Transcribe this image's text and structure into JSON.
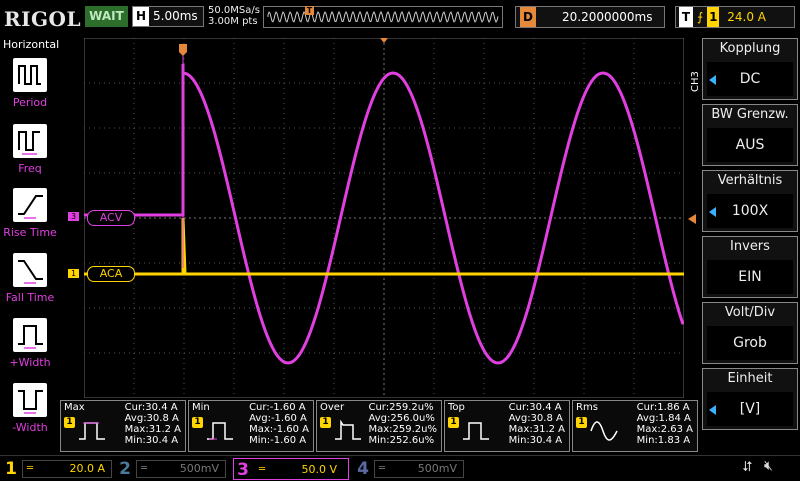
{
  "topbar": {
    "brand": "RIGOL",
    "run_status": "WAIT",
    "horizontal": {
      "key": "H",
      "value": "5.00ms"
    },
    "sample_rate": "50.0MSa/s",
    "memory_depth": "3.00M pts",
    "delay": {
      "key": "D",
      "value": "20.2000000ms"
    },
    "trigger": {
      "key": "T",
      "channel": "1",
      "level": "24.0 A"
    }
  },
  "left_panel": {
    "title": "Horizontal",
    "items": [
      {
        "label": "Period",
        "icon": "period-icon"
      },
      {
        "label": "Freq",
        "icon": "freq-icon"
      },
      {
        "label": "Rise Time",
        "icon": "rise-time-icon"
      },
      {
        "label": "Fall Time",
        "icon": "fall-time-icon"
      },
      {
        "label": "+Width",
        "icon": "pos-width-icon"
      },
      {
        "label": "-Width",
        "icon": "neg-width-icon"
      }
    ]
  },
  "channel_labels": {
    "ch3": {
      "marker": "3",
      "text": "ACV"
    },
    "ch1": {
      "marker": "1",
      "text": "ACA"
    }
  },
  "right_panel": {
    "channel_tag": "CH3",
    "items": [
      {
        "title": "Kopplung",
        "value": "DC",
        "has_arrow": true
      },
      {
        "title": "BW Grenzw.",
        "value": "AUS",
        "has_arrow": false
      },
      {
        "title": "Verhältnis",
        "value": "100X",
        "has_arrow": true
      },
      {
        "title": "Invers",
        "value": "EIN",
        "has_arrow": false
      },
      {
        "title": "Volt/Div",
        "value": "Grob",
        "has_arrow": false
      },
      {
        "title": "Einheit",
        "value": "[V]",
        "has_arrow": true
      }
    ]
  },
  "measurements": [
    {
      "name": "Max",
      "channel": "1",
      "cur": "Cur:30.4 A",
      "avg": "Avg:30.8 A",
      "max": "Max:31.2 A",
      "min": "Min:30.4 A"
    },
    {
      "name": "Min",
      "channel": "1",
      "cur": "Cur:-1.60 A",
      "avg": "Avg:-1.60 A",
      "max": "Max:-1.60 A",
      "min": "Min:-1.60 A"
    },
    {
      "name": "Over",
      "channel": "1",
      "cur": "Cur:259.2u%",
      "avg": "Avg:256.0u%",
      "max": "Max:259.2u%",
      "min": "Min:252.6u%"
    },
    {
      "name": "Top",
      "channel": "1",
      "cur": "Cur:30.4 A",
      "avg": "Avg:30.8 A",
      "max": "Max:31.2 A",
      "min": "Min:30.4 A"
    },
    {
      "name": "Rms",
      "channel": "1",
      "cur": "Cur:1.86 A",
      "avg": "Avg:1.84 A",
      "max": "Max:2.63 A",
      "min": "Min:1.83 A"
    }
  ],
  "channel_bar": [
    {
      "num": "1",
      "scale": "20.0 A",
      "active": true,
      "color": "#ffd400"
    },
    {
      "num": "2",
      "scale": "500mV",
      "active": false,
      "color": "#4a7a9a"
    },
    {
      "num": "3",
      "scale": "50.0 V",
      "active": true,
      "color": "#e040e0"
    },
    {
      "num": "4",
      "scale": "500mV",
      "active": false,
      "color": "#5a6aa0"
    }
  ],
  "colors": {
    "ch1": "#ffd400",
    "ch3": "#e040e0",
    "trigger": "#e6883a",
    "accent": "#3ab0ff"
  }
}
